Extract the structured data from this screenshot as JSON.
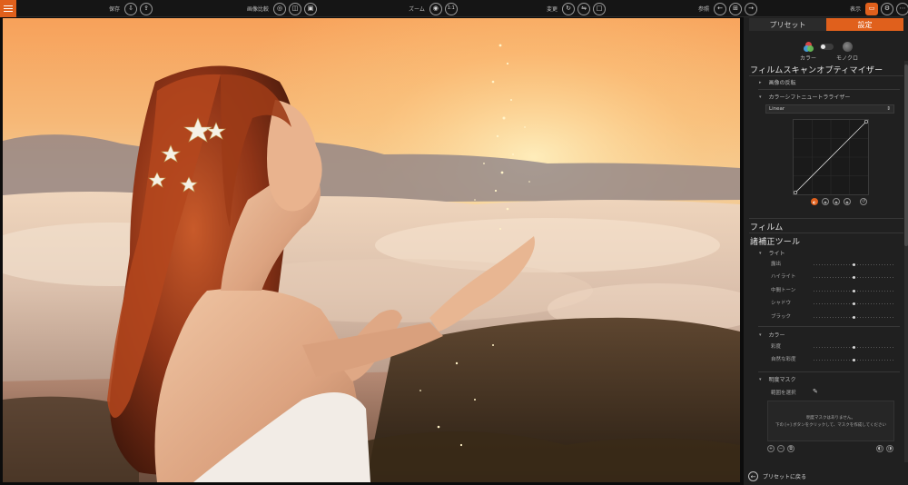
{
  "toolbar": {
    "groups": [
      {
        "label": "保存",
        "icons": [
          "save-export-icon",
          "save-layers-icon"
        ]
      },
      {
        "label": "画像比較",
        "icons": [
          "compare-eye-icon",
          "compare-split-icon",
          "compare-side-icon"
        ]
      },
      {
        "label": "ズーム",
        "icons": [
          "zoom-fit-icon",
          "zoom-100-icon"
        ]
      },
      {
        "label": "変更",
        "icons": [
          "rotate-icon",
          "flip-icon",
          "crop-icon"
        ]
      },
      {
        "label": "参照",
        "icons": [
          "prev-icon",
          "grid-icon",
          "next-icon"
        ]
      },
      {
        "label": "表示",
        "icons": [
          "display-panel-icon",
          "display-settings-icon",
          "display-more-icon"
        ]
      }
    ],
    "zoom_fit_glyph": "◉",
    "zoom_100_glyph": "1:1"
  },
  "panel": {
    "tabs": [
      {
        "label": "プリセット",
        "active": false
      },
      {
        "label": "設定",
        "active": true
      }
    ],
    "mode": {
      "color_label": "カラー",
      "mono_label": "モノクロ"
    },
    "sections": {
      "film_scan": "フィルムスキャンオプティマイザー",
      "invert": "画像の反転",
      "color_shift": "カラーシフトニュートラライザー",
      "dropdown_value": "Linear",
      "film": "フィルム",
      "correction": "諸補正ツール"
    },
    "light": {
      "title": "ライト",
      "sliders": [
        {
          "label": "露出",
          "value": 0.5
        },
        {
          "label": "ハイライト",
          "value": 0.5
        },
        {
          "label": "中間トーン",
          "value": 0.5
        },
        {
          "label": "シャドウ",
          "value": 0.5
        },
        {
          "label": "ブラック",
          "value": 0.5
        }
      ]
    },
    "color": {
      "title": "カラー",
      "sliders": [
        {
          "label": "彩度",
          "value": 0.5
        },
        {
          "label": "自然な彩度",
          "value": 0.5
        }
      ]
    },
    "mask": {
      "title": "明度マスク",
      "select_range": "範囲を選択",
      "empty_line1": "明度マスクはありません。",
      "empty_line2": "下の [+] ボタンをクリックして、マスクを作成してください"
    },
    "back_label": "プリセットに戻る"
  },
  "colors": {
    "accent": "#e0601c",
    "panel_bg": "#202020",
    "toolbar_bg": "#151515"
  }
}
